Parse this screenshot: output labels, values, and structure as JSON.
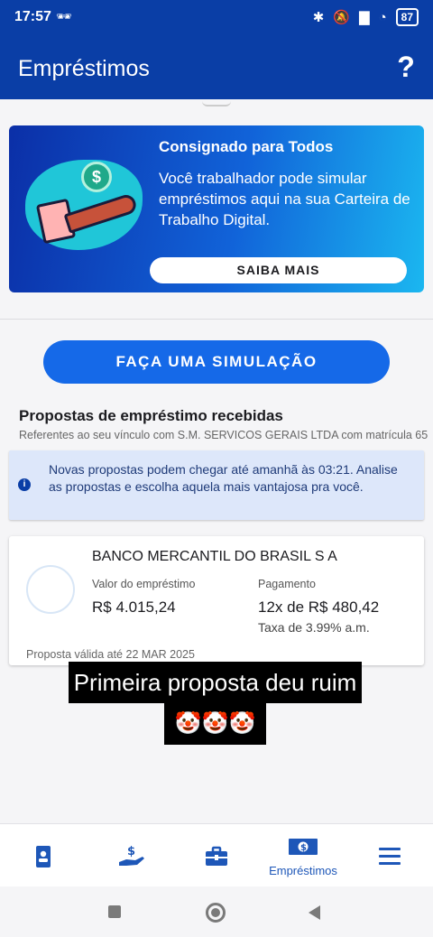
{
  "status_bar": {
    "time": "17:57",
    "battery": "87",
    "icons": [
      "incognito-icon",
      "bluetooth-icon",
      "mute-icon",
      "signal-icon",
      "wifi-icon",
      "battery-icon"
    ]
  },
  "app_bar": {
    "title": "Empréstimos",
    "help_label": "?"
  },
  "banner": {
    "title": "Consignado para Todos",
    "text": "Você trabalhador pode simular empréstimos aqui na sua Carteira de Trabalho Digital.",
    "button_label": "SAIBA MAIS",
    "coin_symbol": "$"
  },
  "simulate_button": "FAÇA UMA SIMULAÇÃO",
  "proposals_section": {
    "title": "Propostas de empréstimo recebidas",
    "subtitle": "Referentes ao seu vínculo com S.M. SERVICOS GERAIS LTDA com matrícula 65"
  },
  "info_box": {
    "icon_label": "i",
    "text": "Novas propostas podem chegar até amanhã às 03:21. Analise as propostas e escolha aquela mais vantajosa pra você."
  },
  "proposal_card": {
    "bank": "BANCO MERCANTIL DO BRASIL S A",
    "loan_label": "Valor do empréstimo",
    "loan_value": "R$ 4.015,24",
    "payment_label": "Pagamento",
    "payment_value": "12x de R$ 480,42",
    "rate": "Taxa de 3.99% a.m.",
    "valid_until": "Proposta válida até 22 MAR 2025"
  },
  "overlay_caption": {
    "line1": "Primeira proposta deu ruim",
    "line2": "🤡🤡🤡"
  },
  "bottom_nav": {
    "items": [
      {
        "icon": "id-card-icon",
        "label": ""
      },
      {
        "icon": "money-hand-icon",
        "label": ""
      },
      {
        "icon": "briefcase-icon",
        "label": ""
      },
      {
        "icon": "banknote-icon",
        "label": "Empréstimos"
      },
      {
        "icon": "menu-icon",
        "label": ""
      }
    ],
    "active_index": 3
  },
  "colors": {
    "primary": "#0a3ea6",
    "accent_button": "#1569e8",
    "info_background": "#dde7fa",
    "nav_icon": "#1e57b8"
  }
}
